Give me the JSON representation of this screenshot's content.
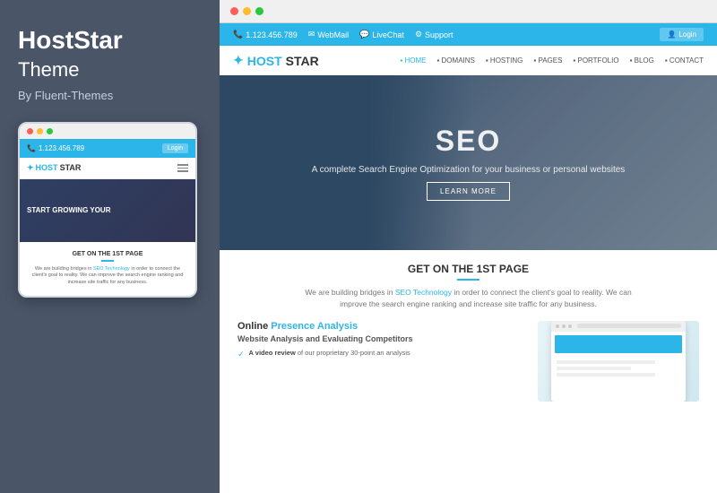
{
  "leftPanel": {
    "title": "HostStar",
    "subtitle": "Theme",
    "author": "By Fluent-Themes",
    "mobile": {
      "phone": "1.123.456.789",
      "loginBtn": "Login",
      "logoHost": "HOST",
      "logoStar": "STAR",
      "heroText": "START GROWING YOUR",
      "heading": "GET ON THE 1ST PAGE",
      "bodyText": "We are building bridges in SEO Technology in order to connect the client's goal to reality. We can improve the search engine ranking and increase site traffic for any business."
    }
  },
  "rightPanel": {
    "browser": {
      "dots": [
        "red",
        "yellow",
        "green"
      ]
    },
    "topbar": {
      "phone": "1.123.456.789",
      "webmail": "WebMail",
      "liveChat": "LiveChat",
      "support": "Support",
      "loginBtn": "Login"
    },
    "navbar": {
      "logoHost": "HOST",
      "logoStar": "STAR",
      "items": [
        "HOME",
        "DOMAINS",
        "HOSTING",
        "PAGES",
        "PORTFOLIO",
        "BLOG",
        "CONTACT"
      ]
    },
    "hero": {
      "title": "SEO",
      "description": "A complete Search Engine Optimization for your business or personal websites",
      "button": "LEARN MORE"
    },
    "content": {
      "heading": "GET ON THE 1ST PAGE",
      "description": "We are building bridges in SEO Technology in order to connect the client's goal to reality. We can improve the search engine ranking and increase site traffic for any business.",
      "onlinePresence": "Online",
      "presenceHighlight": "Presence Analysis",
      "websiteAnalysis": "Website Analysis and Evaluating Competitors",
      "feature": "A video review of our proprietary 30-point an analysis"
    }
  }
}
